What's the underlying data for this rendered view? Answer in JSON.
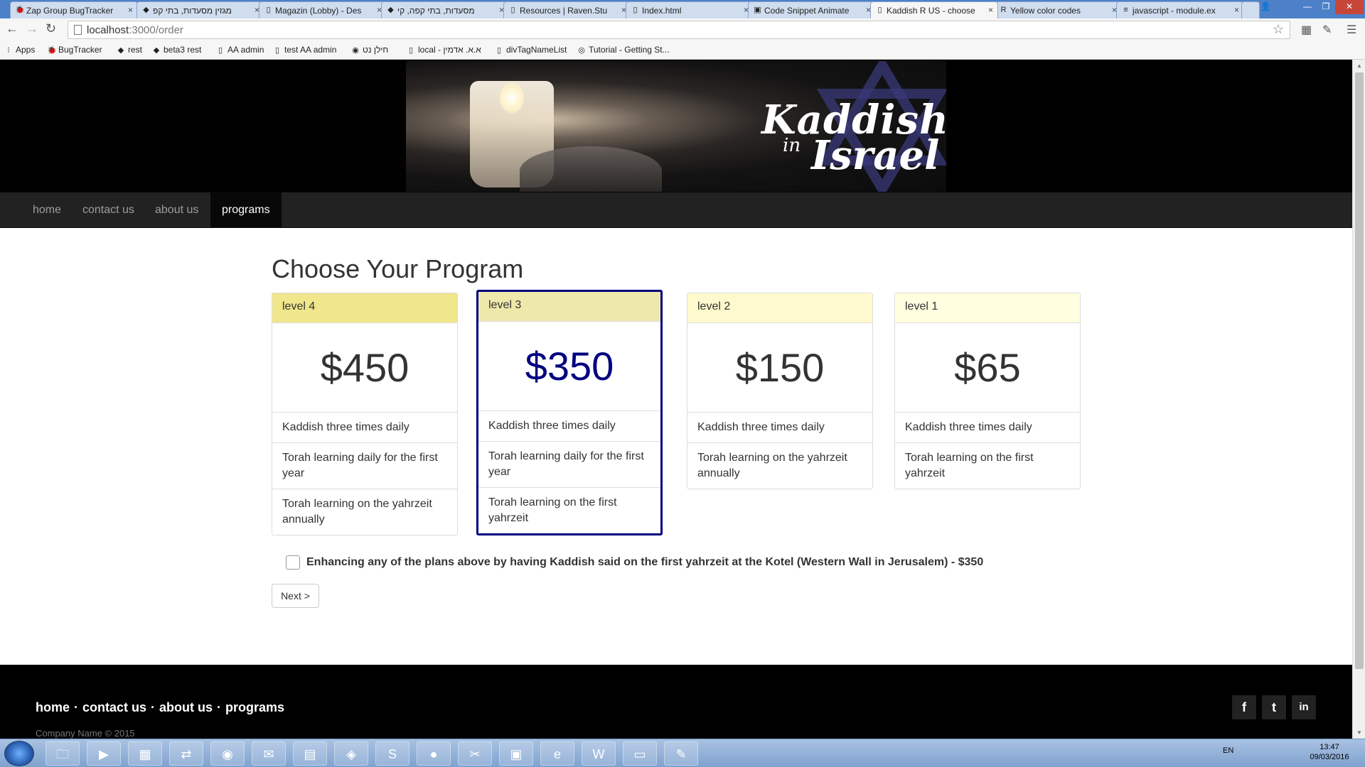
{
  "browser": {
    "tabs": [
      {
        "title": "Zap Group BugTracker",
        "icon": "bug-icon"
      },
      {
        "title": "מגזין מסעדות, בתי קפ",
        "icon": "site-icon"
      },
      {
        "title": "Magazin (Lobby) - Des",
        "icon": "doc-icon"
      },
      {
        "title": "מסעדות, בתי קפה, קי",
        "icon": "site-icon"
      },
      {
        "title": "Resources | Raven.Stu",
        "icon": "doc-icon"
      },
      {
        "title": "Index.html",
        "icon": "doc-icon"
      },
      {
        "title": "Code Snippet Animate",
        "icon": "code-icon"
      },
      {
        "title": "Kaddish R US - choose",
        "icon": "doc-icon"
      },
      {
        "title": "Yellow color codes",
        "icon": "r-icon"
      },
      {
        "title": "javascript - module.ex",
        "icon": "stack-icon"
      }
    ],
    "url_host": "localhost",
    "url_path": ":3000/order",
    "bookmarks": [
      {
        "label": "Apps",
        "icon": "apps-icon"
      },
      {
        "label": "BugTracker",
        "icon": "bug-icon"
      },
      {
        "label": "rest",
        "icon": "site-icon"
      },
      {
        "label": "beta3 rest",
        "icon": "site-icon"
      },
      {
        "label": "AA admin",
        "icon": "doc-icon"
      },
      {
        "label": "test AA admin",
        "icon": "doc-icon"
      },
      {
        "label": "חילן נט",
        "icon": "circle-icon"
      },
      {
        "label": "local - א.א. אדמין",
        "icon": "doc-icon"
      },
      {
        "label": "divTagNameList",
        "icon": "doc-icon"
      },
      {
        "label": "Tutorial - Getting St...",
        "icon": "tutorial-icon"
      }
    ]
  },
  "site": {
    "logo_line1": "Kaddish",
    "logo_line2": "in",
    "logo_line3": "Israel",
    "nav": [
      {
        "label": "home",
        "active": false
      },
      {
        "label": "contact us",
        "active": false
      },
      {
        "label": "about us",
        "active": false
      },
      {
        "label": "programs",
        "active": true
      }
    ]
  },
  "main": {
    "title": "Choose Your Program",
    "plans": [
      {
        "level": "level 4",
        "price": "$450",
        "header_color": "#f0e68c",
        "selected": false,
        "features": [
          "Kaddish three times daily",
          "Torah learning daily for the first year",
          "Torah learning on the yahrzeit annually"
        ]
      },
      {
        "level": "level 3",
        "price": "$350",
        "header_color": "#eee8aa",
        "selected": true,
        "features": [
          "Kaddish three times daily",
          "Torah learning daily for the first year",
          "Torah learning on the first yahrzeit"
        ]
      },
      {
        "level": "level 2",
        "price": "$150",
        "header_color": "#fffacd",
        "selected": false,
        "features": [
          "Kaddish three times daily",
          "Torah learning on the yahrzeit annually"
        ]
      },
      {
        "level": "level 1",
        "price": "$65",
        "header_color": "#ffffe0",
        "selected": false,
        "features": [
          "Kaddish three times daily",
          "Torah learning on the first yahrzeit"
        ]
      }
    ],
    "addon_label": "Enhancing any of the plans above by having Kaddish said on the first yahrzeit at the Kotel (Western Wall in Jerusalem) - $350",
    "addon_checked": false,
    "next_label": "Next >"
  },
  "footer": {
    "links": [
      "home",
      "contact us",
      "about us",
      "programs"
    ],
    "separator": "·",
    "copyright": "Company Name © 2015",
    "social": [
      {
        "icon": "facebook-icon",
        "glyph": "f"
      },
      {
        "icon": "twitter-icon",
        "glyph": "t"
      },
      {
        "icon": "linkedin-icon",
        "glyph": "in"
      }
    ]
  },
  "taskbar": {
    "lang": "EN",
    "time": "13:47",
    "date": "09/03/2016"
  },
  "colors": {
    "selected_border": "#000080",
    "nav_bg": "#222222"
  }
}
